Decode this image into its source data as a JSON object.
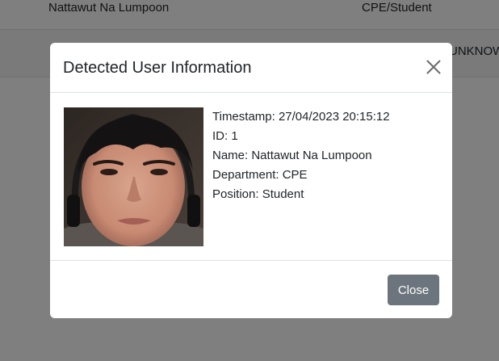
{
  "background_table": {
    "rows": [
      {
        "name": "Nattawut Na Lumpoon",
        "dept_position": "CPE/Student",
        "extra": ""
      },
      {
        "name": "",
        "dept_position": "",
        "extra": "UNKNOWN"
      }
    ]
  },
  "modal": {
    "title": "Detected User Information",
    "photo_alt": "Detected user photo",
    "info": {
      "timestamp": "Timestamp: 27/04/2023 20:15:12",
      "id": "ID: 1",
      "name": "Name: Nattawut Na Lumpoon",
      "department": "Department: CPE",
      "position": "Position: Student"
    },
    "close_label": "Close"
  },
  "icons": {
    "close": "close-icon"
  }
}
